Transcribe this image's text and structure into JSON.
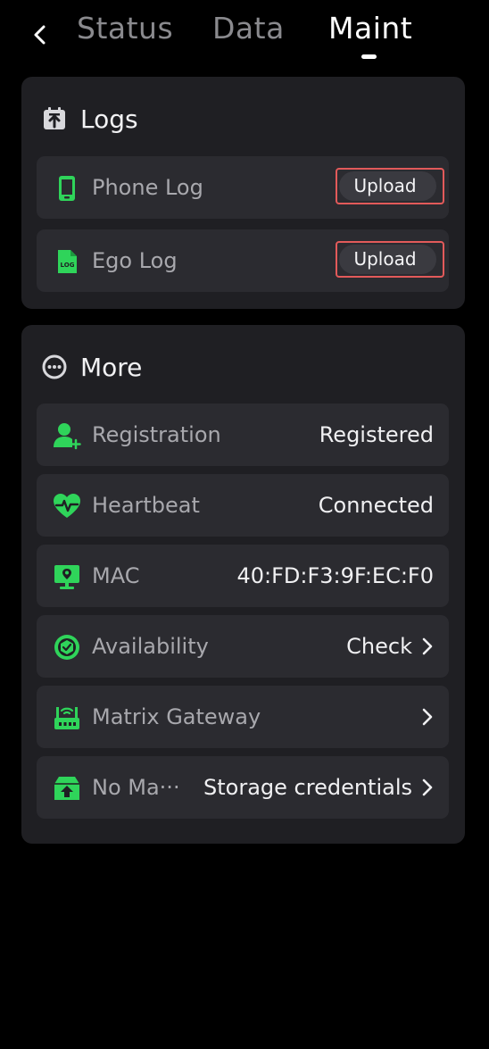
{
  "header": {
    "tabs": [
      {
        "label": "Status"
      },
      {
        "label": "Data"
      },
      {
        "label": "Maint"
      }
    ],
    "active_tab": "Maint"
  },
  "logs": {
    "title": "Logs",
    "items": [
      {
        "label": "Phone Log",
        "button": "Upload",
        "icon": "phone-icon"
      },
      {
        "label": "Ego Log",
        "button": "Upload",
        "icon": "log-file-icon"
      }
    ]
  },
  "more": {
    "title": "More",
    "items": [
      {
        "label": "Registration",
        "value": "Registered",
        "icon": "user-add-icon"
      },
      {
        "label": "Heartbeat",
        "value": "Connected",
        "icon": "heartbeat-icon"
      },
      {
        "label": "MAC",
        "value": "40:FD:F3:9F:EC:F0",
        "icon": "monitor-icon"
      },
      {
        "label": "Availability",
        "value": "Check",
        "icon": "availability-icon"
      },
      {
        "label": "Matrix Gateway",
        "value": "",
        "icon": "router-icon"
      },
      {
        "label": "No Ma···",
        "value": "Storage credentials",
        "icon": "cloud-upload-icon"
      }
    ]
  },
  "colors": {
    "accent": "#2fd45a",
    "card": "#1f1f23",
    "row": "#2b2b30",
    "highlight_border": "#e25a5a"
  }
}
